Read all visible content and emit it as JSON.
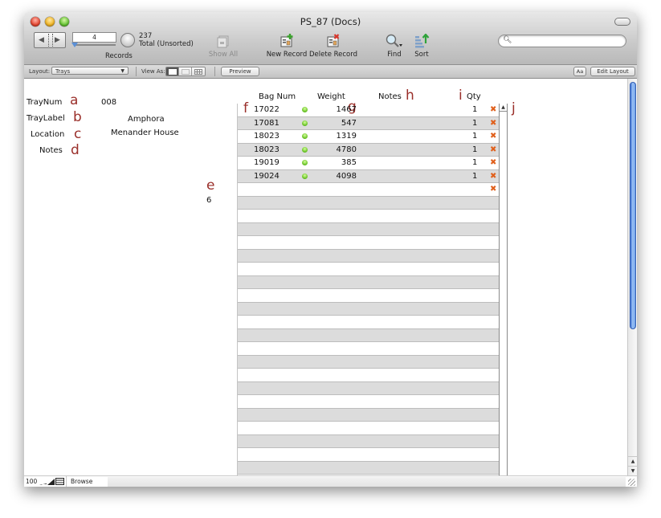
{
  "window": {
    "title": "PS_87 (Docs)"
  },
  "toolbar": {
    "record_number": "4",
    "record_total": "237",
    "record_status": "Total (Unsorted)",
    "records_label": "Records",
    "show_all_label": "Show All",
    "new_record_label": "New Record",
    "delete_record_label": "Delete Record",
    "find_label": "Find",
    "sort_label": "Sort",
    "search_placeholder": ""
  },
  "layout_bar": {
    "layout_label": "Layout:",
    "layout_value": "Trays",
    "view_as_label": "View As:",
    "preview_label": "Preview",
    "text_format_label": "Aa",
    "edit_layout_label": "Edit Layout"
  },
  "form": {
    "fields": [
      {
        "label": "TrayNum",
        "value": "008",
        "annotation": "a"
      },
      {
        "label": "TrayLabel",
        "value": "Amphora",
        "annotation": "b"
      },
      {
        "label": "Location",
        "value": "Menander House",
        "annotation": "c"
      },
      {
        "label": "Notes",
        "value": "",
        "annotation": "d"
      }
    ],
    "count_annotation": "e",
    "count_value": "6"
  },
  "portal": {
    "headers": {
      "bag_num": "Bag Num",
      "weight": "Weight",
      "notes": "Notes",
      "qty": "Qty"
    },
    "annotations": {
      "bag_num": "f",
      "weight": "g",
      "notes": "h",
      "qty": "i",
      "scrollbar": "j"
    },
    "rows": [
      {
        "bag_num": "17022",
        "weight": "1467",
        "notes": "",
        "qty": "1"
      },
      {
        "bag_num": "17081",
        "weight": "547",
        "notes": "",
        "qty": "1"
      },
      {
        "bag_num": "18023",
        "weight": "1319",
        "notes": "",
        "qty": "1"
      },
      {
        "bag_num": "18023",
        "weight": "4780",
        "notes": "",
        "qty": "1"
      },
      {
        "bag_num": "19019",
        "weight": "385",
        "notes": "",
        "qty": "1"
      },
      {
        "bag_num": "19024",
        "weight": "4098",
        "notes": "",
        "qty": "1"
      }
    ],
    "delete_icon": "red-x-delete-icon",
    "status_icon": "green-dot-icon"
  },
  "statusbar": {
    "zoom": "100",
    "mode": "Browse"
  },
  "colors": {
    "annotation": "#9a2f2a",
    "row_alt": "#dcdcdc",
    "delete": "#e0601c",
    "scroll_thumb": "#6fa0ea"
  }
}
